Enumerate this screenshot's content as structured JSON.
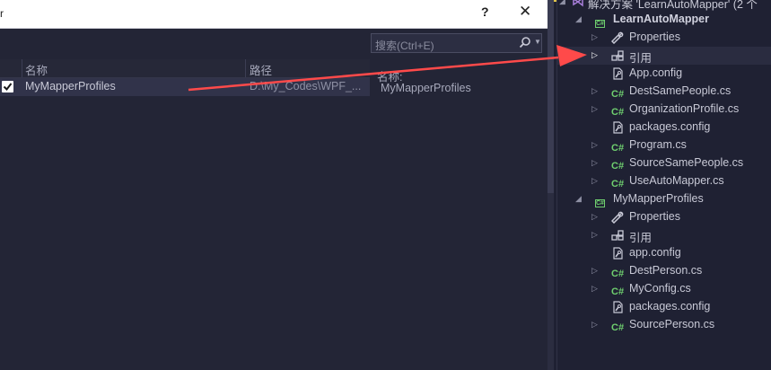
{
  "dialog": {
    "title_fragment": "r",
    "help_label": "?",
    "close_label": "✕",
    "search": {
      "placeholder": "搜索(Ctrl+E)"
    },
    "columns": {
      "name": "名称",
      "path": "路径"
    },
    "rows": [
      {
        "checked": true,
        "name": "MyMapperProfiles",
        "path": "D:\\My_Codes\\WPF_..."
      }
    ],
    "detail": {
      "label": "名称:",
      "value": "MyMapperProfiles"
    }
  },
  "explorer": {
    "solution_label": "解决方案 'LearnAutoMapper' (2 个",
    "items": [
      {
        "label": "LearnAutoMapper",
        "icon": "csharp-project-icon",
        "level": 0,
        "expanded": true,
        "bold": true
      },
      {
        "label": "Properties",
        "icon": "wrench-icon",
        "level": 1,
        "expandable": true
      },
      {
        "label": "引用",
        "icon": "references-icon",
        "level": 1,
        "expandable": true,
        "selected": true
      },
      {
        "label": "App.config",
        "icon": "config-file-icon",
        "level": 1
      },
      {
        "label": "DestSamePeople.cs",
        "icon": "csharp-file-icon",
        "level": 1,
        "expandable": true
      },
      {
        "label": "OrganizationProfile.cs",
        "icon": "csharp-file-icon",
        "level": 1,
        "expandable": true
      },
      {
        "label": "packages.config",
        "icon": "config-file-icon",
        "level": 1
      },
      {
        "label": "Program.cs",
        "icon": "csharp-file-icon",
        "level": 1,
        "expandable": true
      },
      {
        "label": "SourceSamePeople.cs",
        "icon": "csharp-file-icon",
        "level": 1,
        "expandable": true
      },
      {
        "label": "UseAutoMapper.cs",
        "icon": "csharp-file-icon",
        "level": 1,
        "expandable": true
      },
      {
        "label": "MyMapperProfiles",
        "icon": "csharp-project-icon",
        "level": 0,
        "expanded": true
      },
      {
        "label": "Properties",
        "icon": "wrench-icon",
        "level": 1,
        "expandable": true
      },
      {
        "label": "引用",
        "icon": "references-icon",
        "level": 1,
        "expandable": true
      },
      {
        "label": "app.config",
        "icon": "config-file-icon",
        "level": 1
      },
      {
        "label": "DestPerson.cs",
        "icon": "csharp-file-icon",
        "level": 1,
        "expandable": true
      },
      {
        "label": "MyConfig.cs",
        "icon": "csharp-file-icon",
        "level": 1,
        "expandable": true
      },
      {
        "label": "packages.config",
        "icon": "config-file-icon",
        "level": 1
      },
      {
        "label": "SourcePerson.cs",
        "icon": "csharp-file-icon",
        "level": 1,
        "expandable": true
      }
    ]
  },
  "annotation": {
    "color": "#ff4a4a"
  },
  "colors": {
    "accent_green": "#6fcf6f",
    "background": "#1f2133"
  }
}
